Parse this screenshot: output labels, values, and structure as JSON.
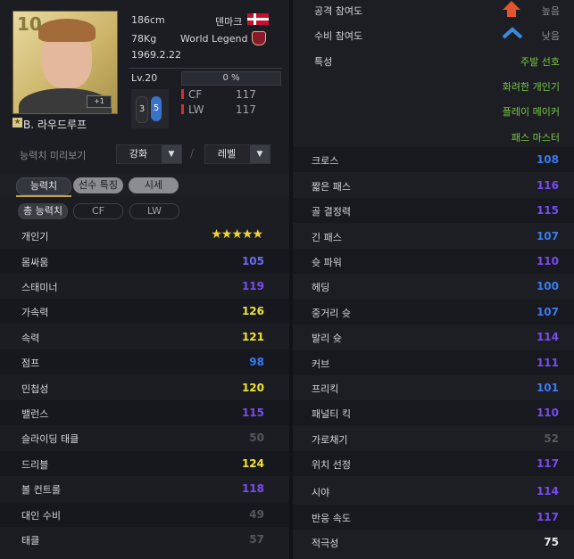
{
  "player": {
    "ovr_partial": "10",
    "name": "B. 라우드루프",
    "plus_badge": "+1",
    "height": "186cm",
    "weight": "78Kg",
    "birth": "1969.2.22",
    "nation": "덴마크",
    "season": "World Legend",
    "level": "Lv.20",
    "level_progress": "0 %",
    "weak_foot": {
      "left": "3",
      "right": "5"
    },
    "positions": [
      {
        "pos": "CF",
        "value": "117"
      },
      {
        "pos": "LW",
        "value": "117"
      }
    ]
  },
  "preview": {
    "label": "능력치 미리보기",
    "enhance": "강화",
    "level": "레벨",
    "slash": "/"
  },
  "tabs": [
    {
      "label": "능력치"
    },
    {
      "label": "선수 특징"
    },
    {
      "label": "시세"
    }
  ],
  "subtabs": [
    {
      "label": "총 능력치"
    },
    {
      "label": "CF"
    },
    {
      "label": "LW"
    }
  ],
  "left_stats": [
    {
      "label": "개인기",
      "stars": "★★★★★"
    },
    {
      "label": "몸싸움",
      "value": "105",
      "color": "#6c6cf2"
    },
    {
      "label": "스태미너",
      "value": "119",
      "color": "#7a4cf0"
    },
    {
      "label": "가속력",
      "value": "126",
      "color": "#f0e23a"
    },
    {
      "label": "속력",
      "value": "121",
      "color": "#f0e23a"
    },
    {
      "label": "점프",
      "value": "98",
      "color": "#3a7af0"
    },
    {
      "label": "민첩성",
      "value": "120",
      "color": "#f0e23a"
    },
    {
      "label": "밸런스",
      "value": "115",
      "color": "#7a4cf0"
    },
    {
      "label": "슬라이딩 태클",
      "value": "50",
      "color": "#55575e"
    },
    {
      "label": "드리블",
      "value": "124",
      "color": "#f0e23a"
    },
    {
      "label": "볼 컨트롤",
      "value": "118",
      "color": "#7a4cf0"
    },
    {
      "label": "대인 수비",
      "value": "49",
      "color": "#55575e"
    },
    {
      "label": "태클",
      "value": "57",
      "color": "#55575e"
    }
  ],
  "top_right": {
    "attack_label": "공격 참여도",
    "attack_value": "높음",
    "defense_label": "수비 참여도",
    "defense_value": "낮음",
    "traits_label": "특성",
    "traits": [
      "주발 선호",
      "화려한 개인기",
      "플레이 메이커",
      "패스 마스터"
    ]
  },
  "right_stats": [
    {
      "label": "크로스",
      "value": "108",
      "color": "#3a7af0"
    },
    {
      "label": "짧은 패스",
      "value": "116",
      "color": "#7a4cf0"
    },
    {
      "label": "골 결정력",
      "value": "115",
      "color": "#7a4cf0"
    },
    {
      "label": "긴 패스",
      "value": "107",
      "color": "#3a7af0"
    },
    {
      "label": "슛 파워",
      "value": "110",
      "color": "#7a4cf0"
    },
    {
      "label": "헤딩",
      "value": "100",
      "color": "#3a7af0"
    },
    {
      "label": "중거리 슛",
      "value": "107",
      "color": "#3a7af0"
    },
    {
      "label": "발리 슛",
      "value": "114",
      "color": "#7a4cf0"
    },
    {
      "label": "커브",
      "value": "111",
      "color": "#7a4cf0"
    },
    {
      "label": "프리킥",
      "value": "101",
      "color": "#3a7af0"
    },
    {
      "label": "패널티 킥",
      "value": "110",
      "color": "#7a4cf0"
    },
    {
      "label": "가로채기",
      "value": "52",
      "color": "#55575e"
    },
    {
      "label": "위치 선정",
      "value": "117",
      "color": "#7a4cf0"
    },
    {
      "label": "시야",
      "value": "114",
      "color": "#7a4cf0"
    },
    {
      "label": "반응 속도",
      "value": "117",
      "color": "#7a4cf0"
    },
    {
      "label": "적극성",
      "value": "75",
      "color": "#e6e6e6"
    }
  ]
}
